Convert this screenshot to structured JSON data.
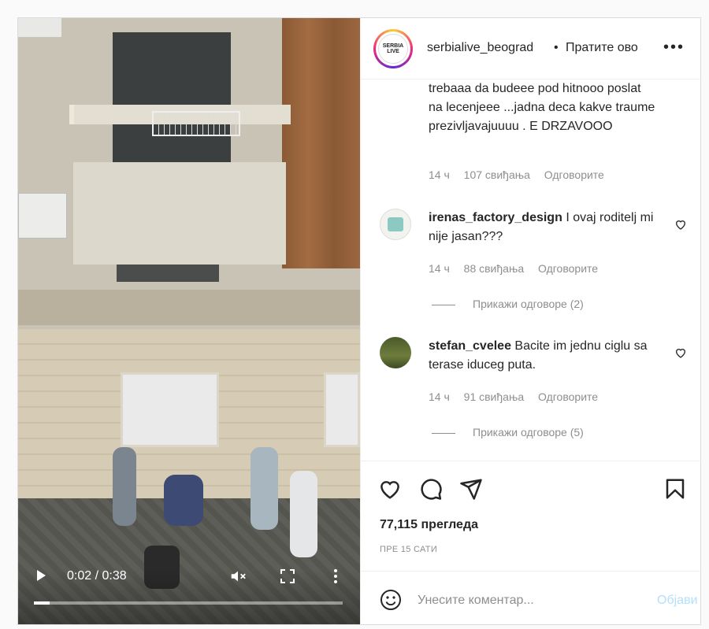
{
  "header": {
    "username": "serbialive_beograd",
    "separator": "•",
    "follow_label": "Пратите ово",
    "avatar_text": "SERBIA LIVE"
  },
  "video": {
    "time": "0:02 / 0:38",
    "progress": 0.05
  },
  "comments": {
    "first_partial_text": "trebaaa da budeee pod hitnooo poslat na lecenjeee ...jadna deca kakve traume prezivljavajuuuu . E DRZAVOOO",
    "first_meta": {
      "time": "14 ч",
      "likes": "107 свиђања",
      "reply": "Одговорите"
    },
    "items": [
      {
        "username": "irenas_factory_design",
        "text": "I ovaj roditelj mi nije jasan???",
        "time": "14 ч",
        "likes": "88 свиђања",
        "reply": "Одговорите",
        "replies_label": "Прикажи одговоре (2)"
      },
      {
        "username": "stefan_cvelee",
        "text": "Bacite im jednu ciglu sa terase iduceg puta.",
        "time": "14 ч",
        "likes": "91 свиђања",
        "reply": "Одговорите",
        "replies_label": "Прикажи одговоре (5)"
      }
    ]
  },
  "stats": {
    "views": "77,115 прегледа",
    "posted_ago": "ПРЕ 15 САТИ"
  },
  "comment_box": {
    "placeholder": "Унесите коментар...",
    "post_label": "Објави"
  },
  "colors": {
    "text": "#262626",
    "muted": "#8e8e8e",
    "post_disabled": "#b2dffc",
    "border": "#dbdbdb"
  }
}
